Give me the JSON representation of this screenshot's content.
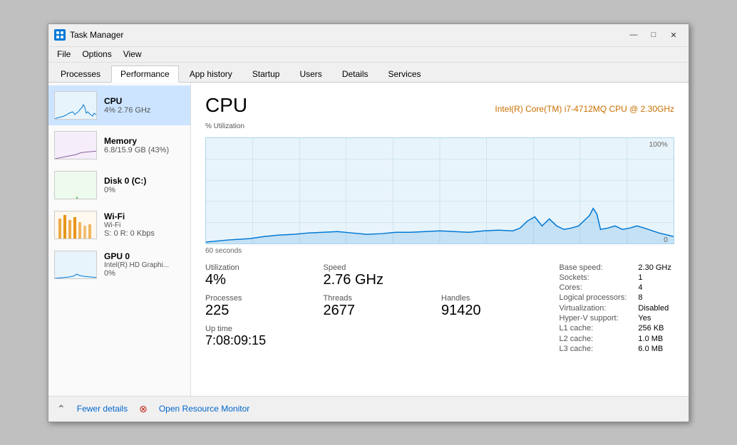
{
  "window": {
    "title": "Task Manager",
    "icon": "TM"
  },
  "title_buttons": {
    "minimize": "—",
    "maximize": "□",
    "close": "✕"
  },
  "menu": {
    "items": [
      "File",
      "Options",
      "View"
    ]
  },
  "tabs": {
    "items": [
      "Processes",
      "Performance",
      "App history",
      "Startup",
      "Users",
      "Details",
      "Services"
    ],
    "active": "Performance"
  },
  "sidebar": {
    "items": [
      {
        "id": "cpu",
        "label": "CPU",
        "sub": "4% 2.76 GHz",
        "color": "#0078d4",
        "selected": true
      },
      {
        "id": "memory",
        "label": "Memory",
        "sub": "6.8/15.9 GB (43%)",
        "color": "#8b5e9c",
        "selected": false
      },
      {
        "id": "disk",
        "label": "Disk 0 (C:)",
        "sub": "0%",
        "color": "#4caf50",
        "selected": false
      },
      {
        "id": "wifi",
        "label": "Wi-Fi",
        "sub2": "Wi-Fi",
        "sub": "S: 0  R: 0 Kbps",
        "color": "#e68a00",
        "selected": false
      },
      {
        "id": "gpu",
        "label": "GPU 0",
        "sub2": "Intel(R) HD Graphi...",
        "sub": "0%",
        "color": "#0078d4",
        "selected": false
      }
    ]
  },
  "main": {
    "title": "CPU",
    "model": "Intel(R) Core(TM) i7-4712MQ CPU @ 2.30GHz",
    "chart": {
      "y_label": "% Utilization",
      "top_value": "100%",
      "bottom_value": "0",
      "time_label": "60 seconds"
    },
    "stats": {
      "utilization_label": "Utilization",
      "utilization_value": "4%",
      "speed_label": "Speed",
      "speed_value": "2.76 GHz",
      "processes_label": "Processes",
      "processes_value": "225",
      "threads_label": "Threads",
      "threads_value": "2677",
      "handles_label": "Handles",
      "handles_value": "91420",
      "uptime_label": "Up time",
      "uptime_value": "7:08:09:15"
    },
    "info": {
      "base_speed_label": "Base speed:",
      "base_speed_value": "2.30 GHz",
      "sockets_label": "Sockets:",
      "sockets_value": "1",
      "cores_label": "Cores:",
      "cores_value": "4",
      "logical_label": "Logical processors:",
      "logical_value": "8",
      "virtualization_label": "Virtualization:",
      "virtualization_value": "Disabled",
      "hyperv_label": "Hyper-V support:",
      "hyperv_value": "Yes",
      "l1_label": "L1 cache:",
      "l1_value": "256 KB",
      "l2_label": "L2 cache:",
      "l2_value": "1.0 MB",
      "l3_label": "L3 cache:",
      "l3_value": "6.0 MB"
    }
  },
  "footer": {
    "fewer_details": "Fewer details",
    "open_resource_monitor": "Open Resource Monitor"
  }
}
